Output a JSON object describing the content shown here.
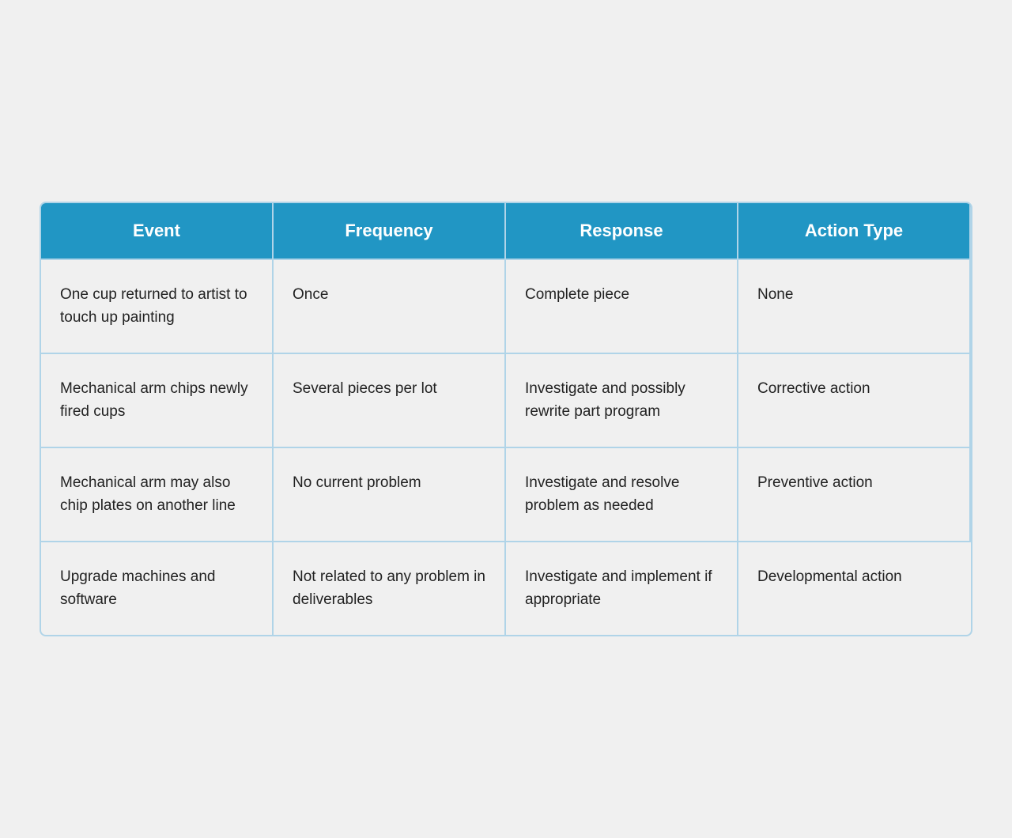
{
  "table": {
    "headers": [
      {
        "id": "event",
        "label": "Event"
      },
      {
        "id": "frequency",
        "label": "Frequency"
      },
      {
        "id": "response",
        "label": "Response"
      },
      {
        "id": "action_type",
        "label": "Action Type"
      }
    ],
    "rows": [
      {
        "event": "One cup returned to artist to touch up painting",
        "frequency": "Once",
        "response": "Complete piece",
        "action_type": "None"
      },
      {
        "event": "Mechanical arm chips newly fired cups",
        "frequency": "Several pieces per lot",
        "response": "Investigate and possibly rewrite part program",
        "action_type": "Corrective action"
      },
      {
        "event": "Mechanical arm may also chip plates on another line",
        "frequency": "No current problem",
        "response": "Investigate and resolve problem as needed",
        "action_type": "Preventive action"
      },
      {
        "event": "Upgrade machines and software",
        "frequency": "Not related to any problem in deliverables",
        "response": "Investigate and implement if appropriate",
        "action_type": "Developmental action"
      }
    ]
  }
}
